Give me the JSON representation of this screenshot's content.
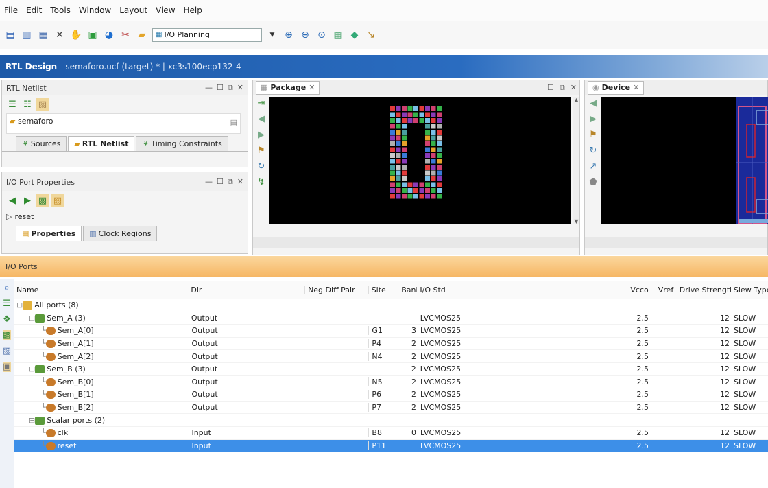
{
  "menu": [
    "File",
    "Edit",
    "Tools",
    "Window",
    "Layout",
    "View",
    "Help"
  ],
  "toolbar": {
    "layout_value": "I/O Planning",
    "icons": [
      "save-icon",
      "open-icon",
      "delete-icon",
      "cut-icon",
      "run-icon",
      "settings-icon",
      "tools-icon",
      "folder-icon",
      "zoom-in-icon",
      "zoom-out-icon",
      "zoom-fit-icon",
      "pin-icon",
      "gear-icon",
      "probe-icon"
    ]
  },
  "title": {
    "main": "RTL Design",
    "sub": "- semaforo.ucf (target) * | xc3s100ecp132-4"
  },
  "rtl_netlist": {
    "title": "RTL Netlist",
    "item": "semaforo",
    "tabs": [
      "Sources",
      "RTL Netlist",
      "Timing Constraints"
    ]
  },
  "io_port_props": {
    "title": "I/O Port Properties",
    "item": "reset",
    "tabs": [
      "Properties",
      "Clock Regions"
    ]
  },
  "package_tab": "Package",
  "device_tab": "Device",
  "io_ports": {
    "title": "I/O Ports",
    "columns": [
      "Name",
      "Dir",
      "Neg Diff Pair",
      "Site",
      "Bank",
      "I/O Std",
      "Vcco",
      "Vref",
      "Drive Strength",
      "Slew Type"
    ],
    "rows": [
      {
        "name": "All ports (8)",
        "dir": "",
        "neg": "",
        "site": "",
        "bank": "",
        "std": "",
        "vcco": "",
        "vref": "",
        "drive": "",
        "slew": "",
        "level": 0
      },
      {
        "name": "Sem_A (3)",
        "dir": "Output",
        "neg": "",
        "site": "",
        "bank": "",
        "std": "LVCMOS25",
        "vcco": "2.5",
        "vref": "",
        "drive": "12",
        "slew": "SLOW",
        "level": 1
      },
      {
        "name": "Sem_A[0]",
        "dir": "Output",
        "neg": "",
        "site": "G1",
        "bank": "3",
        "std": "LVCMOS25",
        "vcco": "2.5",
        "vref": "",
        "drive": "12",
        "slew": "SLOW",
        "level": 2
      },
      {
        "name": "Sem_A[1]",
        "dir": "Output",
        "neg": "",
        "site": "P4",
        "bank": "2",
        "std": "LVCMOS25",
        "vcco": "2.5",
        "vref": "",
        "drive": "12",
        "slew": "SLOW",
        "level": 2
      },
      {
        "name": "Sem_A[2]",
        "dir": "Output",
        "neg": "",
        "site": "N4",
        "bank": "2",
        "std": "LVCMOS25",
        "vcco": "2.5",
        "vref": "",
        "drive": "12",
        "slew": "SLOW",
        "level": 2
      },
      {
        "name": "Sem_B (3)",
        "dir": "Output",
        "neg": "",
        "site": "",
        "bank": "2",
        "std": "LVCMOS25",
        "vcco": "2.5",
        "vref": "",
        "drive": "12",
        "slew": "SLOW",
        "level": 1
      },
      {
        "name": "Sem_B[0]",
        "dir": "Output",
        "neg": "",
        "site": "N5",
        "bank": "2",
        "std": "LVCMOS25",
        "vcco": "2.5",
        "vref": "",
        "drive": "12",
        "slew": "SLOW",
        "level": 2
      },
      {
        "name": "Sem_B[1]",
        "dir": "Output",
        "neg": "",
        "site": "P6",
        "bank": "2",
        "std": "LVCMOS25",
        "vcco": "2.5",
        "vref": "",
        "drive": "12",
        "slew": "SLOW",
        "level": 2
      },
      {
        "name": "Sem_B[2]",
        "dir": "Output",
        "neg": "",
        "site": "P7",
        "bank": "2",
        "std": "LVCMOS25",
        "vcco": "2.5",
        "vref": "",
        "drive": "12",
        "slew": "SLOW",
        "level": 2
      },
      {
        "name": "Scalar ports (2)",
        "dir": "",
        "neg": "",
        "site": "",
        "bank": "",
        "std": "",
        "vcco": "",
        "vref": "",
        "drive": "",
        "slew": "",
        "level": 1
      },
      {
        "name": "clk",
        "dir": "Input",
        "neg": "",
        "site": "B8",
        "bank": "0",
        "std": "LVCMOS25",
        "vcco": "2.5",
        "vref": "",
        "drive": "12",
        "slew": "SLOW",
        "level": 2
      },
      {
        "name": "reset",
        "dir": "Input",
        "neg": "",
        "site": "P11",
        "bank": "",
        "std": "LVCMOS25",
        "vcco": "2.5",
        "vref": "",
        "drive": "12",
        "slew": "SLOW",
        "level": 2
      }
    ]
  },
  "colors": {
    "title_bar": "#1e5aa8",
    "io_header": "#f6b765",
    "selection": "#3d8fe8"
  }
}
